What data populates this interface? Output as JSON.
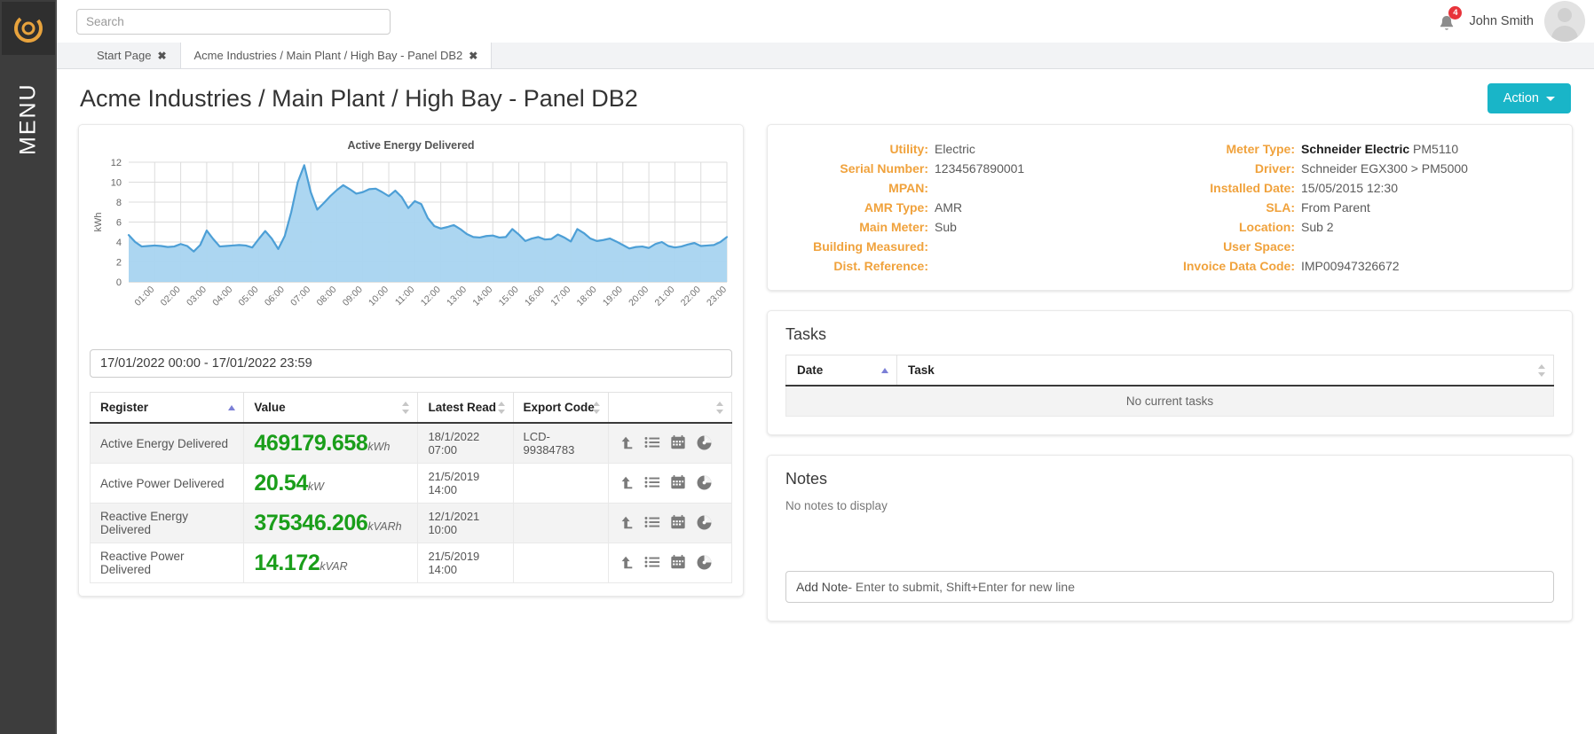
{
  "brand": {
    "accent": "#19b5c8",
    "label_color": "#f0a23c",
    "value_green": "#1a9e1a",
    "chart_blue": "#5aaee0"
  },
  "rail": {
    "menu_label": "MENU",
    "logo_icon": "circle-logo-icon"
  },
  "topbar": {
    "search_placeholder": "Search",
    "search_value": "",
    "notifications_count": "4",
    "user_name": "John Smith"
  },
  "tabs": [
    {
      "label": "Start Page",
      "close": "✖",
      "active": false
    },
    {
      "label": "Acme Industries / Main Plant / High Bay - Panel DB2",
      "close": "✖",
      "active": true
    }
  ],
  "page": {
    "title": "Acme Industries / Main Plant / High Bay - Panel DB2",
    "action_label": "Action"
  },
  "chart_data": {
    "type": "area",
    "title": "Active Energy Delivered",
    "xlabel": "",
    "ylabel": "kWh",
    "ylim": [
      0,
      12
    ],
    "yticks": [
      0,
      2,
      4,
      6,
      8,
      10,
      12
    ],
    "grid": true,
    "legend": "none",
    "categories": [
      "01:00",
      "02:00",
      "03:00",
      "04:00",
      "05:00",
      "06:00",
      "07:00",
      "08:00",
      "09:00",
      "10:00",
      "11:00",
      "12:00",
      "13:00",
      "14:00",
      "15:00",
      "16:00",
      "17:00",
      "18:00",
      "19:00",
      "20:00",
      "21:00",
      "22:00",
      "23:00"
    ],
    "x": [
      0.0,
      0.25,
      0.5,
      0.75,
      1.0,
      1.25,
      1.5,
      1.75,
      2.0,
      2.25,
      2.5,
      2.75,
      3.0,
      3.25,
      3.5,
      3.75,
      4.0,
      4.25,
      4.5,
      4.75,
      5.0,
      5.25,
      5.5,
      5.75,
      6.0,
      6.25,
      6.5,
      6.75,
      7.0,
      7.25,
      7.5,
      7.75,
      8.0,
      8.25,
      8.5,
      8.75,
      9.0,
      9.25,
      9.5,
      9.75,
      10.0,
      10.25,
      10.5,
      10.75,
      11.0,
      11.25,
      11.5,
      11.75,
      12.0,
      12.25,
      12.5,
      12.75,
      13.0,
      13.25,
      13.5,
      13.75,
      14.0,
      14.25,
      14.5,
      14.75,
      15.0,
      15.25,
      15.5,
      15.75,
      16.0,
      16.25,
      16.5,
      16.75,
      17.0,
      17.25,
      17.5,
      17.75,
      18.0,
      18.25,
      18.5,
      18.75,
      19.0,
      19.25,
      19.5,
      19.75,
      20.0,
      20.25,
      20.5,
      20.75,
      21.0,
      21.25,
      21.5,
      21.75,
      22.0,
      22.25,
      22.5,
      22.75,
      23.0
    ],
    "values": [
      4.7,
      4.0,
      3.55,
      3.6,
      3.65,
      3.6,
      3.5,
      3.55,
      3.8,
      3.6,
      3.05,
      3.7,
      5.15,
      4.3,
      3.55,
      3.6,
      3.65,
      3.7,
      3.65,
      3.45,
      4.3,
      5.1,
      4.35,
      3.3,
      4.6,
      7.0,
      10.0,
      11.7,
      9.0,
      7.25,
      7.9,
      8.6,
      9.2,
      9.7,
      9.3,
      8.85,
      9.0,
      9.3,
      9.35,
      9.0,
      8.6,
      9.15,
      8.5,
      7.4,
      8.1,
      7.8,
      6.4,
      5.6,
      5.35,
      5.5,
      5.7,
      5.3,
      4.8,
      4.5,
      4.45,
      4.6,
      4.65,
      4.45,
      4.5,
      5.3,
      4.75,
      4.1,
      4.35,
      4.5,
      4.25,
      4.3,
      4.75,
      4.45,
      4.05,
      5.3,
      4.9,
      4.35,
      4.1,
      4.2,
      4.35,
      4.05,
      3.7,
      3.35,
      3.5,
      3.55,
      3.4,
      3.8,
      4.0,
      3.6,
      3.45,
      3.55,
      3.75,
      3.9,
      3.6,
      3.65,
      3.7,
      4.0,
      4.5
    ]
  },
  "date_range": {
    "value": "17/01/2022 00:00 - 17/01/2022 23:59"
  },
  "register_table": {
    "columns": [
      {
        "label": "Register",
        "sort": "asc"
      },
      {
        "label": "Value",
        "sort": "both"
      },
      {
        "label": "Latest Read",
        "sort": "both"
      },
      {
        "label": "Export Code",
        "sort": "both"
      },
      {
        "label": "",
        "sort": "both"
      }
    ],
    "rows": [
      {
        "register": "Active Energy Delivered",
        "value": "469179.658",
        "unit": "kWh",
        "latest_read": "18/1/2022 07:00",
        "export_code": "LCD-99384783"
      },
      {
        "register": "Active Power Delivered",
        "value": "20.54",
        "unit": "kW",
        "latest_read": "21/5/2019 14:00",
        "export_code": ""
      },
      {
        "register": "Reactive Energy Delivered",
        "value": "375346.206",
        "unit": "kVARh",
        "latest_read": "12/1/2021 10:00",
        "export_code": ""
      },
      {
        "register": "Reactive Power Delivered",
        "value": "14.172",
        "unit": "kVAR",
        "latest_read": "21/5/2019 14:00",
        "export_code": ""
      }
    ],
    "row_icons": [
      "level-up-icon",
      "list-icon",
      "calendar-icon",
      "gauge-icon"
    ]
  },
  "details": {
    "left": [
      {
        "label": "Utility:",
        "value": "Electric"
      },
      {
        "label": "Serial Number:",
        "value": "1234567890001"
      },
      {
        "label": "MPAN:",
        "value": ""
      },
      {
        "label": "AMR Type:",
        "value": "AMR"
      },
      {
        "label": "Main Meter:",
        "value": "Sub"
      },
      {
        "label": "Building Measured:",
        "value": ""
      },
      {
        "label": "Dist. Reference:",
        "value": ""
      }
    ],
    "right": [
      {
        "label": "Meter Type:",
        "value_strong": "Schneider Electric",
        "value": "PM5110"
      },
      {
        "label": "Driver:",
        "value_strong": "",
        "value": "Schneider EGX300 > PM5000"
      },
      {
        "label": "Installed Date:",
        "value_strong": "",
        "value": "15/05/2015 12:30"
      },
      {
        "label": "SLA:",
        "value_strong": "",
        "value": "From Parent"
      },
      {
        "label": "Location:",
        "value_strong": "",
        "value": "Sub 2"
      },
      {
        "label": "User Space:",
        "value_strong": "",
        "value": ""
      },
      {
        "label": "Invoice Data Code:",
        "value_strong": "",
        "value": "IMP00947326672"
      }
    ]
  },
  "tasks": {
    "heading": "Tasks",
    "columns": [
      {
        "label": "Date",
        "sort": "asc"
      },
      {
        "label": "Task",
        "sort": "both"
      }
    ],
    "empty_text": "No current tasks"
  },
  "notes": {
    "heading": "Notes",
    "empty_text": "No notes to display",
    "input_lead": "Add Note",
    "input_hint": " - Enter to submit, Shift+Enter for new line"
  }
}
